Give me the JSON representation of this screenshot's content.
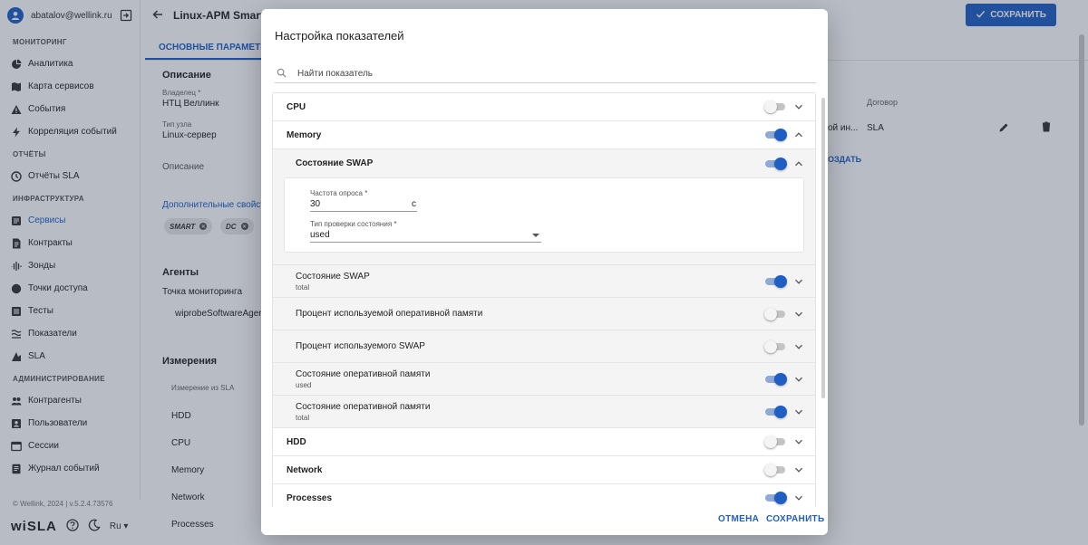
{
  "app": {
    "user_email": "abatalov@wellink.ru",
    "page_title": "Linux-APM Smart HD",
    "save_label": "СОХРАНИТЬ",
    "tab_main": "ОСНОВНЫЕ ПАРАМЕТРЫ",
    "copyright": "© Wellink, 2024 | v.5.2.4.73576",
    "logo": "wiSLA",
    "lang": "Ru",
    "accent_color": "#1f5fc4"
  },
  "sidebar": {
    "sections": [
      {
        "title": "МОНИТОРИНГ",
        "items": [
          {
            "label": "Аналитика",
            "icon": "pie-chart-icon"
          },
          {
            "label": "Карта сервисов",
            "icon": "map-icon"
          },
          {
            "label": "События",
            "icon": "warning-icon"
          },
          {
            "label": "Корреляция событий",
            "icon": "bolt-icon"
          }
        ]
      },
      {
        "title": "ОТЧЁТЫ",
        "items": [
          {
            "label": "Отчёты SLA",
            "icon": "report-icon"
          }
        ]
      },
      {
        "title": "ИНФРАСТРУКТУРА",
        "items": [
          {
            "label": "Сервисы",
            "icon": "services-icon"
          },
          {
            "label": "Контракты",
            "icon": "contract-icon"
          },
          {
            "label": "Зонды",
            "icon": "probe-icon"
          },
          {
            "label": "Точки доступа",
            "icon": "access-point-icon"
          },
          {
            "label": "Тесты",
            "icon": "tests-icon"
          },
          {
            "label": "Показатели",
            "icon": "metrics-icon"
          },
          {
            "label": "SLA",
            "icon": "sla-icon"
          }
        ]
      },
      {
        "title": "АДМИНИСТРИРОВАНИЕ",
        "items": [
          {
            "label": "Контрагенты",
            "icon": "people-icon"
          },
          {
            "label": "Пользователи",
            "icon": "user-icon"
          },
          {
            "label": "Сессии",
            "icon": "session-icon"
          },
          {
            "label": "Журнал событий",
            "icon": "journal-icon"
          }
        ]
      }
    ]
  },
  "content": {
    "description_title": "Описание",
    "owner_label": "Владелец *",
    "owner_value": "НТЦ Веллинк",
    "node_type_label": "Тип узла",
    "node_type_value": "Linux-сервер",
    "description_field": "Описание",
    "extra_props": "Дополнительные свойства",
    "chips": [
      "SMART",
      "DC"
    ],
    "agents_title": "Агенты",
    "monitoring_point": "Точка мониторинга",
    "agent_name": "wiprobeSoftwareAgent-",
    "measurements_title": "Измерения",
    "measurement_col": "Измерение из SLA",
    "measurements": [
      "HDD",
      "CPU",
      "Memory",
      "Network",
      "Processes"
    ],
    "contract_col": "Договор",
    "contract_value": "SLA",
    "truncated_cell": "ой ин...",
    "create_link": "ОЗДАТЬ"
  },
  "modal": {
    "title": "Настройка показателей",
    "search_placeholder": "Найти показатель",
    "cancel_label": "ОТМЕНА",
    "save_label": "СОХРАНИТЬ",
    "groups": {
      "cpu": {
        "label": "CPU",
        "enabled": false,
        "expanded": false
      },
      "memory": {
        "label": "Memory",
        "enabled": true,
        "expanded": true
      },
      "swap_state": {
        "label": "Состояние SWAP",
        "enabled": true,
        "expanded": true
      },
      "hdd": {
        "label": "HDD",
        "enabled": false,
        "expanded": false
      },
      "network": {
        "label": "Network",
        "enabled": false,
        "expanded": false
      },
      "processes": {
        "label": "Processes",
        "enabled": true,
        "expanded": false
      }
    },
    "settings": {
      "poll_label": "Частота опроса *",
      "poll_value": "30",
      "poll_unit": "с",
      "check_label": "Тип проверки состояния *",
      "check_value": "used"
    },
    "metrics": [
      {
        "label": "Состояние SWAP",
        "sub": "total",
        "enabled": true
      },
      {
        "label": "Процент используемой оперативной памяти",
        "sub": "",
        "enabled": false
      },
      {
        "label": "Процент используемого SWAP",
        "sub": "",
        "enabled": false
      },
      {
        "label": "Состояние оперативной памяти",
        "sub": "used",
        "enabled": true
      },
      {
        "label": "Состояние оперативной памяти",
        "sub": "total",
        "enabled": true
      }
    ]
  }
}
